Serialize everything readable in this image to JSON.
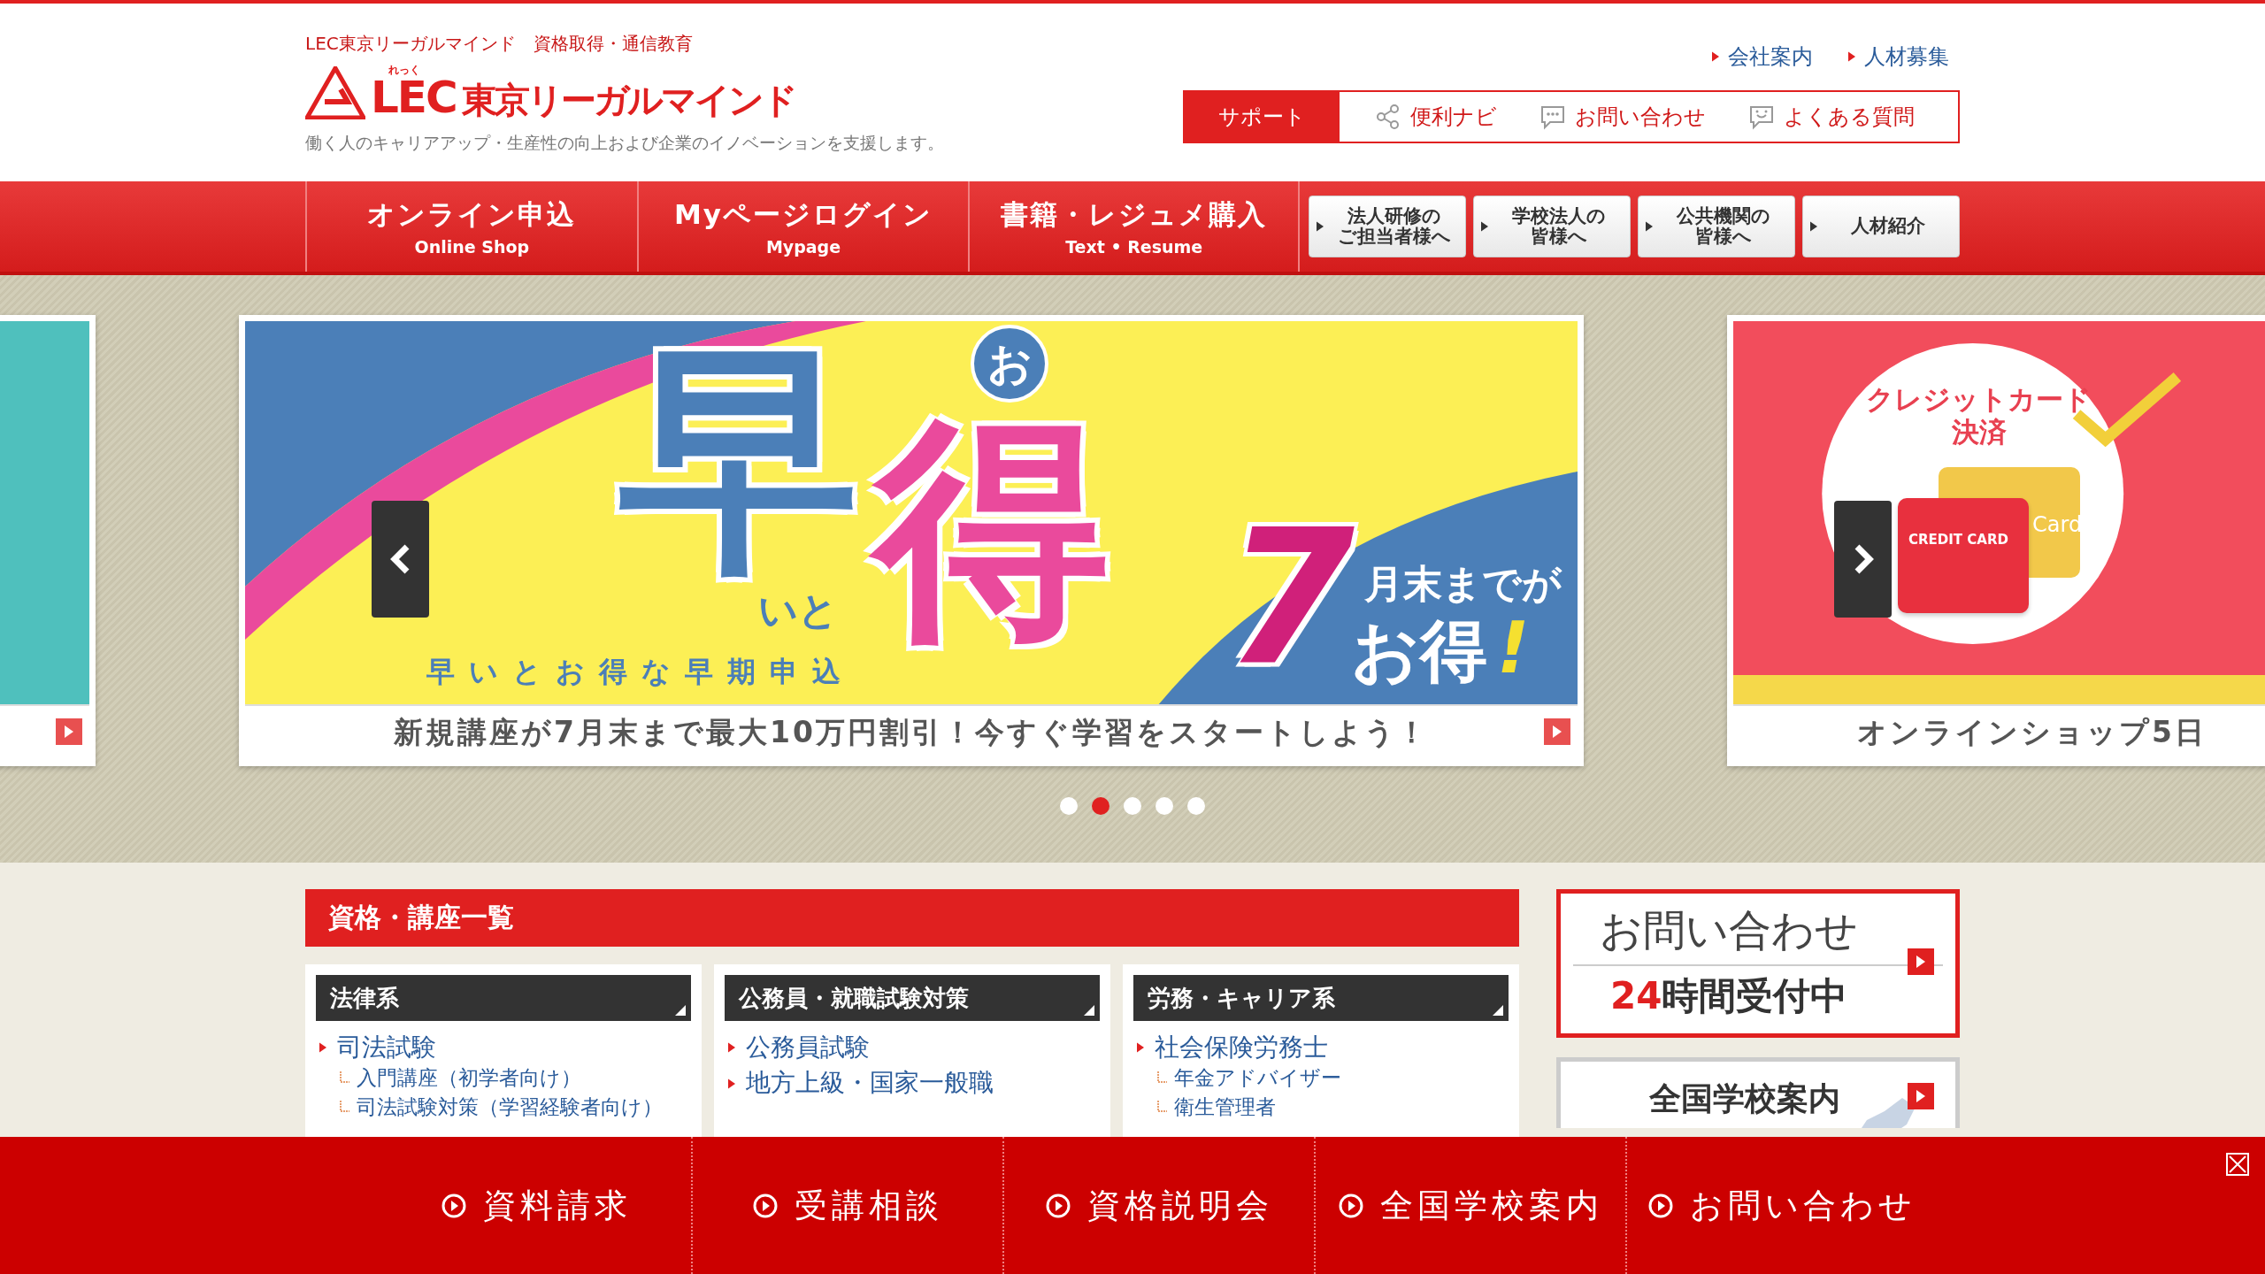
{
  "header": {
    "tagline": "LEC東京リーガルマインド　資格取得・通信教育",
    "logo_kana": "れっく",
    "logo_mark": "LEC",
    "logo_text": "東京リーガルマインド",
    "description": "働く人のキャリアアップ・生産性の向上および企業のイノベーションを支援します。",
    "top_links": [
      "会社案内",
      "人材募集"
    ],
    "support": {
      "label": "サポート",
      "items": [
        {
          "label": "便利ナビ"
        },
        {
          "label": "お問い合わせ"
        },
        {
          "label": "よくある質問"
        }
      ]
    }
  },
  "nav": {
    "tabs": [
      {
        "label": "オンライン申込",
        "sub": "Online Shop"
      },
      {
        "label": "Myページログイン",
        "sub": "Mypage"
      },
      {
        "label": "書籍・レジュメ購入",
        "sub": "Text • Resume"
      }
    ],
    "buttons": [
      {
        "lines": [
          "法人研修の",
          "ご担当者様へ"
        ]
      },
      {
        "lines": [
          "学校法人の",
          "皆様へ"
        ]
      },
      {
        "lines": [
          "公共機関の",
          "皆様へ"
        ]
      },
      {
        "lines": [
          "人材紹介"
        ]
      }
    ]
  },
  "carousel": {
    "slides": [
      {
        "kind": "teal"
      },
      {
        "kind": "early",
        "caption": "新規講座が7月末まで最大10万円割引！今すぐ学習をスタートしよう！",
        "art": {
          "big1": "早",
          "big2": "得",
          "badge": "お",
          "small": "いと",
          "subtitle": "早いとお得な早期申込",
          "number": "7",
          "line1": "月末までが",
          "line2": "お得",
          "exclaim": "!"
        }
      },
      {
        "kind": "credit",
        "caption": "オンラインショップ5日",
        "art": {
          "title_lines": [
            "クレジットカード",
            "決済"
          ],
          "card_front": "CREDIT CARD",
          "card_back": "Card"
        }
      }
    ],
    "dots": [
      {
        "selected": false
      },
      {
        "selected": true
      },
      {
        "selected": false
      },
      {
        "selected": false
      },
      {
        "selected": false
      }
    ]
  },
  "courses": {
    "title": "資格・講座一覧",
    "columns": [
      {
        "title": "法律系",
        "items": [
          {
            "label": "司法試験",
            "children": [
              {
                "label": "入門講座（初学者向け）"
              },
              {
                "label": "司法試験対策（学習経験者向け）"
              }
            ]
          }
        ]
      },
      {
        "title": "公務員・就職試験対策",
        "items": [
          {
            "label": "公務員試験"
          },
          {
            "label": "地方上級・国家一般職"
          }
        ]
      },
      {
        "title": "労務・キャリア系",
        "items": [
          {
            "label": "社会保険労務士",
            "children": [
              {
                "label": "年金アドバイザー"
              },
              {
                "label": "衛生管理者"
              }
            ]
          }
        ]
      }
    ]
  },
  "side": {
    "contact": {
      "title": "お問い合わせ",
      "hours": "24",
      "hours_suffix": "時間受付中"
    },
    "schools": {
      "title": "全国学校案内"
    }
  },
  "bottom_bar": {
    "items": [
      "資料請求",
      "受講相談",
      "資格説明会",
      "全国学校案内",
      "お問い合わせ"
    ]
  }
}
